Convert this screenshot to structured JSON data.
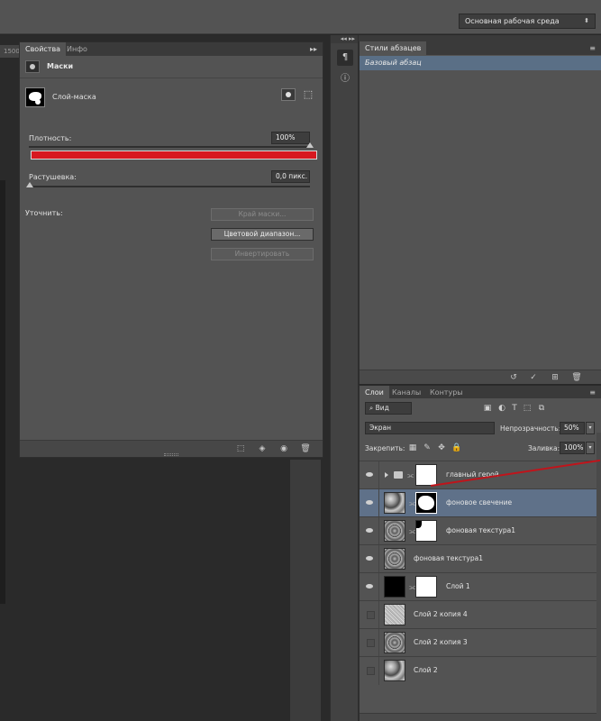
{
  "topbar": {
    "workspace": "Основная рабочая среда"
  },
  "ruler": {
    "label": "1500"
  },
  "properties": {
    "tabs": [
      "Свойства",
      "Инфо"
    ],
    "section_title": "Маски",
    "layer_mask_label": "Слой-маска",
    "density_label": "Плотность:",
    "density_value": "100%",
    "feather_label": "Растушевка:",
    "feather_value": "0,0 пикс.",
    "refine_label": "Уточнить:",
    "buttons": {
      "mask_edge": "Край маски...",
      "color_range": "Цветовой диапазон...",
      "invert": "Инвертировать"
    }
  },
  "paragraph_styles": {
    "tab": "Стили абзацев",
    "item": "Базовый абзац"
  },
  "layers_panel": {
    "tabs": [
      "Слои",
      "Каналы",
      "Контуры"
    ],
    "filter": "Вид",
    "blend_mode": "Экран",
    "opacity_label": "Непрозрачность:",
    "opacity_value": "50%",
    "lock_label": "Закрепить:",
    "fill_label": "Заливка:",
    "fill_value": "100%",
    "layers": [
      {
        "name": "главный герой",
        "visible": true,
        "selected": false
      },
      {
        "name": "фоновое свечение",
        "visible": true,
        "selected": true
      },
      {
        "name": "фоновая текстура1",
        "visible": true,
        "selected": false
      },
      {
        "name": "фоновая текстура1",
        "visible": true,
        "selected": false
      },
      {
        "name": "Слой 1",
        "visible": true,
        "selected": false
      },
      {
        "name": "Слой 2 копия 4",
        "visible": false,
        "selected": false
      },
      {
        "name": "Слой 2 копия 3",
        "visible": false,
        "selected": false
      },
      {
        "name": "Слой 2",
        "visible": false,
        "selected": false
      }
    ]
  },
  "colors": {
    "panel": "#535353",
    "selection": "#5f7189",
    "highlight_red": "#d7181f"
  }
}
